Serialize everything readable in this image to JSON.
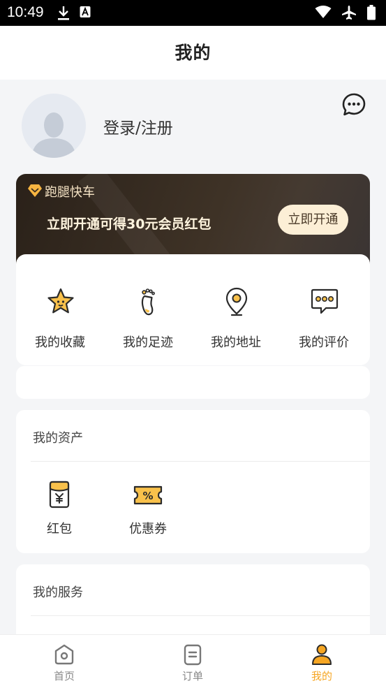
{
  "status_bar": {
    "time": "10:49"
  },
  "header": {
    "title": "我的"
  },
  "profile": {
    "login_label": "登录/注册"
  },
  "vip": {
    "brand": "跑腿快车",
    "offer": "立即开通可得30元会员红包",
    "cta": "立即开通"
  },
  "quick_actions": [
    {
      "label": "我的收藏",
      "icon": "star-icon"
    },
    {
      "label": "我的足迹",
      "icon": "footprint-icon"
    },
    {
      "label": "我的地址",
      "icon": "location-pin-icon"
    },
    {
      "label": "我的评价",
      "icon": "comment-icon"
    }
  ],
  "assets": {
    "title": "我的资产",
    "items": [
      {
        "label": "红包",
        "icon": "red-envelope-icon"
      },
      {
        "label": "优惠券",
        "icon": "coupon-icon"
      }
    ]
  },
  "services": {
    "title": "我的服务"
  },
  "tabs": [
    {
      "label": "首页",
      "icon": "home-icon",
      "active": false
    },
    {
      "label": "订单",
      "icon": "order-icon",
      "active": false
    },
    {
      "label": "我的",
      "icon": "profile-icon",
      "active": true
    }
  ],
  "colors": {
    "accent": "#f6a623",
    "icon_yellow": "#f9c14b",
    "vip_dark": "#2a2119"
  }
}
